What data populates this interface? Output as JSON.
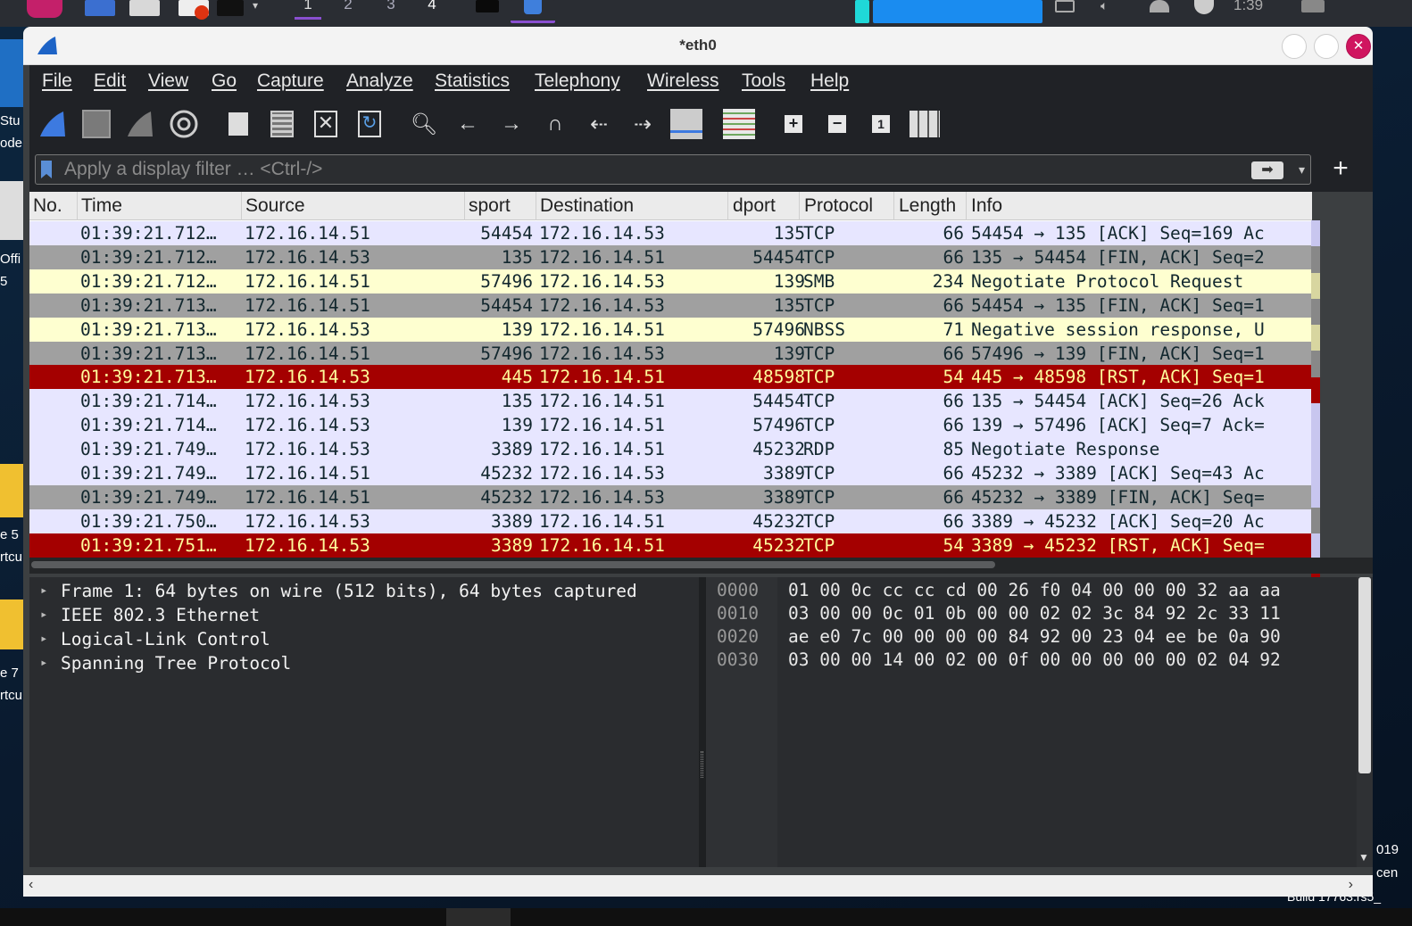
{
  "taskbar": {
    "workspaces": [
      "1",
      "2",
      "3",
      "4"
    ],
    "clock": "1:39"
  },
  "desktop": {
    "left_labels": [
      "Stu",
      "ode",
      "Offi",
      "5",
      "e 5",
      "rtcu",
      "e 7",
      "rtcu"
    ],
    "right_labels": [
      "019",
      "cen",
      "Build 17763.rs5_"
    ]
  },
  "window": {
    "title": "*eth0"
  },
  "menubar": [
    "File",
    "Edit",
    "View",
    "Go",
    "Capture",
    "Analyze",
    "Statistics",
    "Telephony",
    "Wireless",
    "Tools",
    "Help"
  ],
  "toolbar_icons": [
    "shark-fin-start-icon",
    "stop-square-icon",
    "restart-fin-icon",
    "gear-options-icon",
    "open-file-icon",
    "save-file-icon",
    "close-file-icon",
    "reload-file-icon",
    "search-icon",
    "back-arrow-icon",
    "forward-arrow-icon",
    "jump-to-packet-icon",
    "first-packet-icon",
    "last-packet-icon",
    "autoscroll-icon",
    "colorize-icon",
    "zoom-in-icon",
    "zoom-out-icon",
    "normal-size-icon",
    "resize-columns-icon"
  ],
  "filter": {
    "placeholder": "Apply a display filter … <Ctrl-/>"
  },
  "columns": [
    "No.",
    "Time",
    "Source",
    "sport",
    "Destination",
    "dport",
    "Protocol",
    "Length",
    "Info"
  ],
  "row_colors": {
    "ack": {
      "bg": "#e7e6ff",
      "fg": "#12272e"
    },
    "fin": {
      "bg": "#a0a0a0",
      "fg": "#12272e"
    },
    "smb": {
      "bg": "#feffd0",
      "fg": "#12272e"
    },
    "rst": {
      "bg": "#a40000",
      "fg": "#fffc9c"
    }
  },
  "packets": [
    {
      "time": "01:39:21.712…",
      "source": "172.16.14.51",
      "sport": "54454",
      "destination": "172.16.14.53",
      "dport": "135",
      "protocol": "TCP",
      "length": "66",
      "info": "54454 → 135 [ACK] Seq=169 Ac",
      "style": "ack"
    },
    {
      "time": "01:39:21.712…",
      "source": "172.16.14.53",
      "sport": "135",
      "destination": "172.16.14.51",
      "dport": "54454",
      "protocol": "TCP",
      "length": "66",
      "info": "135 → 54454 [FIN, ACK] Seq=2",
      "style": "fin"
    },
    {
      "time": "01:39:21.712…",
      "source": "172.16.14.51",
      "sport": "57496",
      "destination": "172.16.14.53",
      "dport": "139",
      "protocol": "SMB",
      "length": "234",
      "info": "Negotiate Protocol Request",
      "style": "smb"
    },
    {
      "time": "01:39:21.713…",
      "source": "172.16.14.51",
      "sport": "54454",
      "destination": "172.16.14.53",
      "dport": "135",
      "protocol": "TCP",
      "length": "66",
      "info": "54454 → 135 [FIN, ACK] Seq=1",
      "style": "fin"
    },
    {
      "time": "01:39:21.713…",
      "source": "172.16.14.53",
      "sport": "139",
      "destination": "172.16.14.51",
      "dport": "57496",
      "protocol": "NBSS",
      "length": "71",
      "info": "Negative session response, U",
      "style": "smb"
    },
    {
      "time": "01:39:21.713…",
      "source": "172.16.14.51",
      "sport": "57496",
      "destination": "172.16.14.53",
      "dport": "139",
      "protocol": "TCP",
      "length": "66",
      "info": "57496 → 139 [FIN, ACK] Seq=1",
      "style": "fin"
    },
    {
      "time": "01:39:21.713…",
      "source": "172.16.14.53",
      "sport": "445",
      "destination": "172.16.14.51",
      "dport": "48598",
      "protocol": "TCP",
      "length": "54",
      "info": "445 → 48598 [RST, ACK] Seq=1",
      "style": "rst"
    },
    {
      "time": "01:39:21.714…",
      "source": "172.16.14.53",
      "sport": "135",
      "destination": "172.16.14.51",
      "dport": "54454",
      "protocol": "TCP",
      "length": "66",
      "info": "135 → 54454 [ACK] Seq=26 Ack",
      "style": "ack"
    },
    {
      "time": "01:39:21.714…",
      "source": "172.16.14.53",
      "sport": "139",
      "destination": "172.16.14.51",
      "dport": "57496",
      "protocol": "TCP",
      "length": "66",
      "info": "139 → 57496 [ACK] Seq=7 Ack=",
      "style": "ack"
    },
    {
      "time": "01:39:21.749…",
      "source": "172.16.14.53",
      "sport": "3389",
      "destination": "172.16.14.51",
      "dport": "45232",
      "protocol": "RDP",
      "length": "85",
      "info": "Negotiate Response",
      "style": "ack"
    },
    {
      "time": "01:39:21.749…",
      "source": "172.16.14.51",
      "sport": "45232",
      "destination": "172.16.14.53",
      "dport": "3389",
      "protocol": "TCP",
      "length": "66",
      "info": "45232 → 3389 [ACK] Seq=43 Ac",
      "style": "ack"
    },
    {
      "time": "01:39:21.749…",
      "source": "172.16.14.51",
      "sport": "45232",
      "destination": "172.16.14.53",
      "dport": "3389",
      "protocol": "TCP",
      "length": "66",
      "info": "45232 → 3389 [FIN, ACK] Seq=",
      "style": "fin"
    },
    {
      "time": "01:39:21.750…",
      "source": "172.16.14.53",
      "sport": "3389",
      "destination": "172.16.14.51",
      "dport": "45232",
      "protocol": "TCP",
      "length": "66",
      "info": "3389 → 45232 [ACK] Seq=20 Ac",
      "style": "ack"
    },
    {
      "time": "01:39:21.751…",
      "source": "172.16.14.53",
      "sport": "3389",
      "destination": "172.16.14.51",
      "dport": "45232",
      "protocol": "TCP",
      "length": "54",
      "info": "3389 → 45232 [RST, ACK] Seq=",
      "style": "rst"
    }
  ],
  "details": [
    "Frame 1: 64 bytes on wire (512 bits), 64 bytes captured",
    "IEEE 802.3 Ethernet",
    "Logical-Link Control",
    "Spanning Tree Protocol"
  ],
  "bytes": [
    {
      "offset": "0000",
      "hex": "01 00 0c cc cc cd 00 26  f0 04 00 00 00 32 aa aa"
    },
    {
      "offset": "0010",
      "hex": "03 00 00 0c 01 0b 00 00  02 02 3c 84 92 2c 33 11"
    },
    {
      "offset": "0020",
      "hex": "ae e0 7c 00 00 00 00 84  92 00 23 04 ee be 0a 90"
    },
    {
      "offset": "0030",
      "hex": "03 00 00 14 00 02 00 0f  00 00 00 00 00 02 04 92"
    }
  ]
}
